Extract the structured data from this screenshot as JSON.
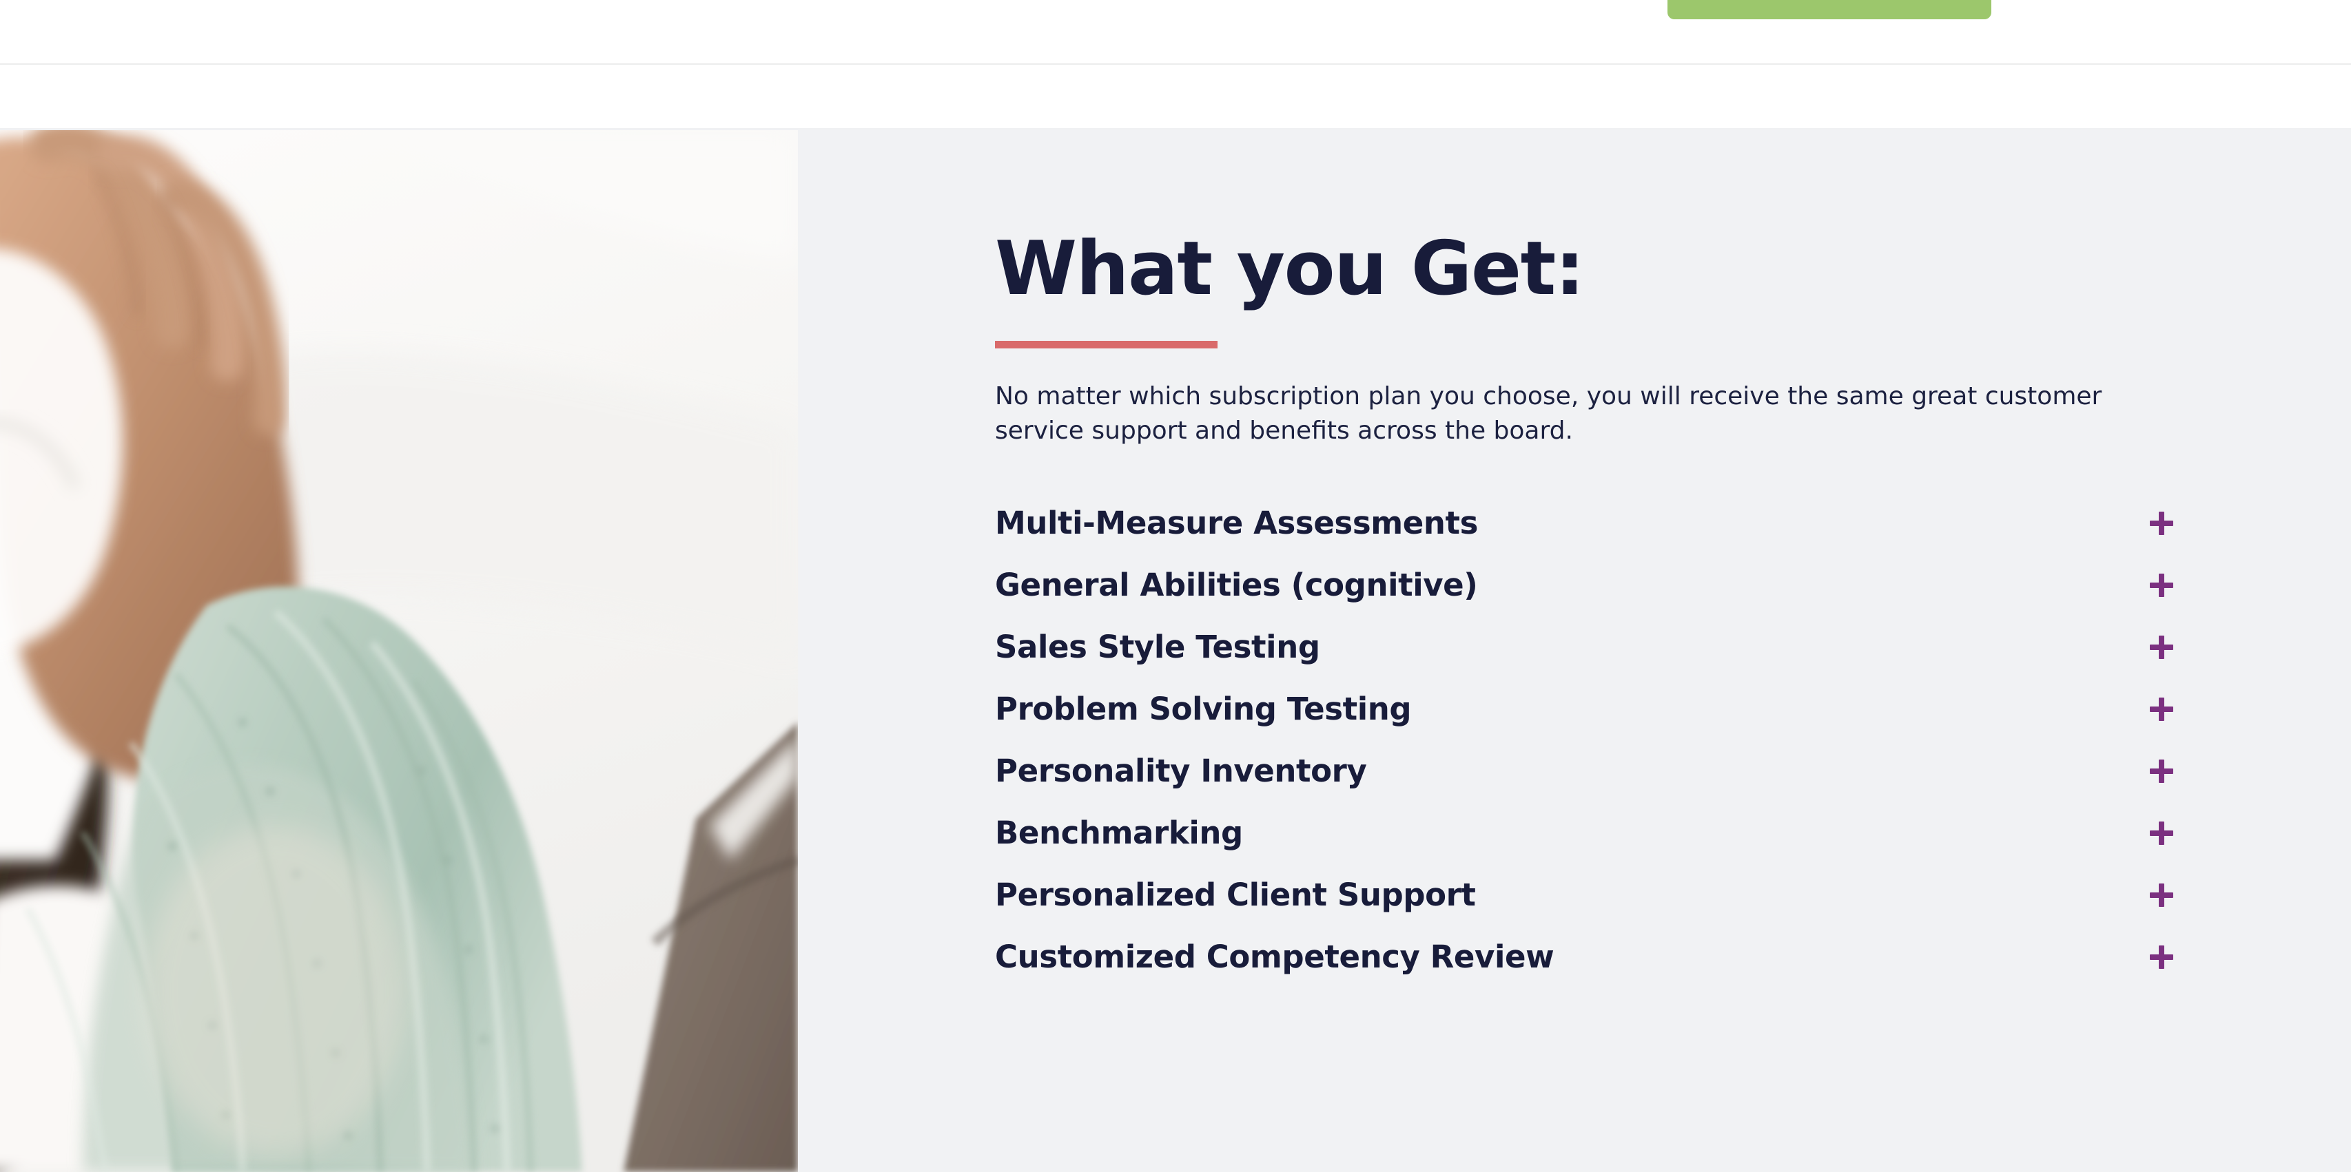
{
  "top_bar": {
    "cta_label": "",
    "cta_color": "#9cc76c"
  },
  "section": {
    "background_color": "#f1f2f4",
    "heading": "What you Get:",
    "heading_color": "#181c3a",
    "accent_bar_color": "#d96a6a",
    "lede": "No matter which subscription plan you choose, you will receive the same great customer service support and benefits across the board.",
    "photo_alt": "Woman in mint green knit sweater working on a laptop"
  },
  "accordion": {
    "expand_icon": "plus-icon",
    "expand_icon_color": "#7b3080",
    "items": [
      {
        "label": "Multi-Measure Assessments",
        "toggle": "+"
      },
      {
        "label": "General Abilities (cognitive)",
        "toggle": "+"
      },
      {
        "label": "Sales Style Testing",
        "toggle": "+"
      },
      {
        "label": "Problem Solving Testing",
        "toggle": "+"
      },
      {
        "label": "Personality Inventory",
        "toggle": "+"
      },
      {
        "label": "Benchmarking",
        "toggle": "+"
      },
      {
        "label": "Personalized Client Support",
        "toggle": "+"
      },
      {
        "label": "Customized Competency Review",
        "toggle": "+"
      }
    ]
  }
}
